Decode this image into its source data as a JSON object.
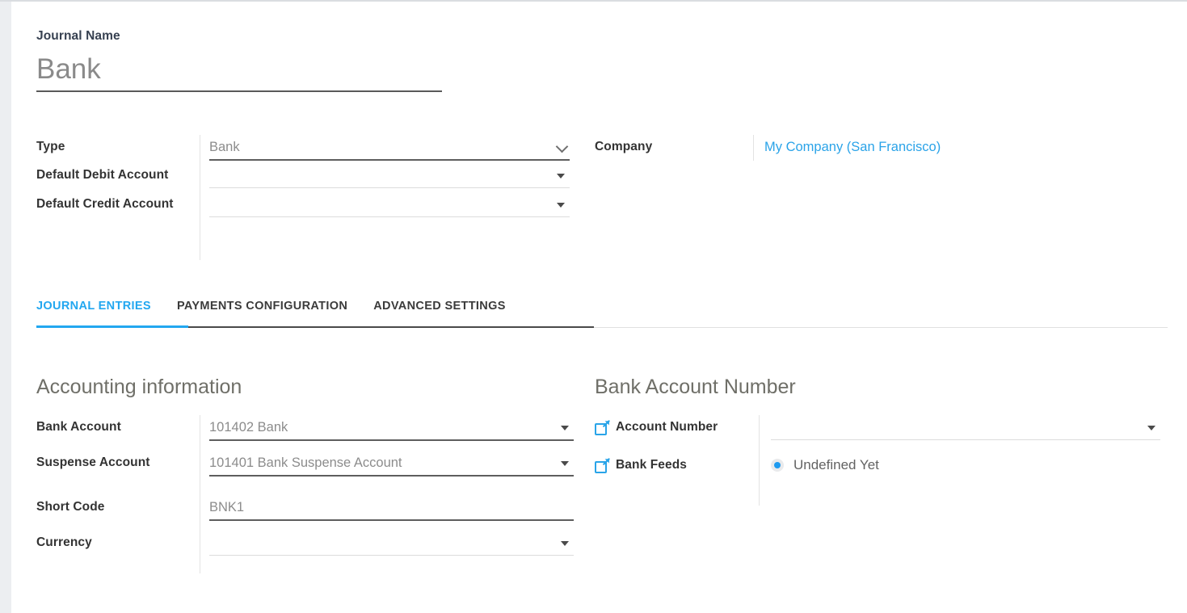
{
  "form": {
    "title_label": "Journal Name",
    "title_value": "Bank"
  },
  "header_fields": {
    "left": [
      {
        "label": "Type",
        "value": "Bank",
        "control": "select",
        "caret": "chevron-down-icon",
        "underline": "dark"
      },
      {
        "label": "Default Debit Account",
        "value": "",
        "control": "dropdown",
        "caret": "caret-down-icon",
        "underline": "light"
      },
      {
        "label": "Default Credit Account",
        "value": "",
        "control": "dropdown",
        "caret": "caret-down-icon",
        "underline": "light"
      }
    ],
    "right": [
      {
        "label": "Company",
        "value": "My Company (San Francisco)",
        "control": "link"
      }
    ]
  },
  "tabs": [
    {
      "label": "JOURNAL ENTRIES",
      "active": true
    },
    {
      "label": "PAYMENTS CONFIGURATION",
      "active": false
    },
    {
      "label": "ADVANCED SETTINGS",
      "active": false
    }
  ],
  "accounting_information": {
    "heading": "Accounting information",
    "fields": [
      {
        "label": "Bank Account",
        "value": "101402 Bank",
        "control": "dropdown",
        "caret": "caret-down-icon",
        "underline": "dark"
      },
      {
        "label": "Suspense Account",
        "value": "101401 Bank Suspense Account",
        "control": "dropdown",
        "caret": "caret-down-icon",
        "underline": "dark"
      },
      {
        "label": "Short Code",
        "value": "BNK1",
        "control": "text",
        "caret": "",
        "underline": "dark"
      },
      {
        "label": "Currency",
        "value": "",
        "control": "dropdown",
        "caret": "caret-down-icon",
        "underline": "light"
      }
    ]
  },
  "bank_account_number": {
    "heading": "Bank Account Number",
    "fields": [
      {
        "icon": "external-link-icon",
        "label": "Account Number",
        "value": "",
        "control": "dropdown",
        "caret": "caret-down-icon",
        "underline": "light"
      },
      {
        "icon": "external-link-icon",
        "label": "Bank Feeds",
        "value": "Undefined Yet",
        "control": "radio",
        "selected": true
      }
    ]
  },
  "colors": {
    "accent_blue": "#22a7f0",
    "link_blue": "#2aa3e8",
    "label_dark": "#333333",
    "value_gray": "#8c8c8c",
    "heading_gray": "#6f6f68"
  }
}
